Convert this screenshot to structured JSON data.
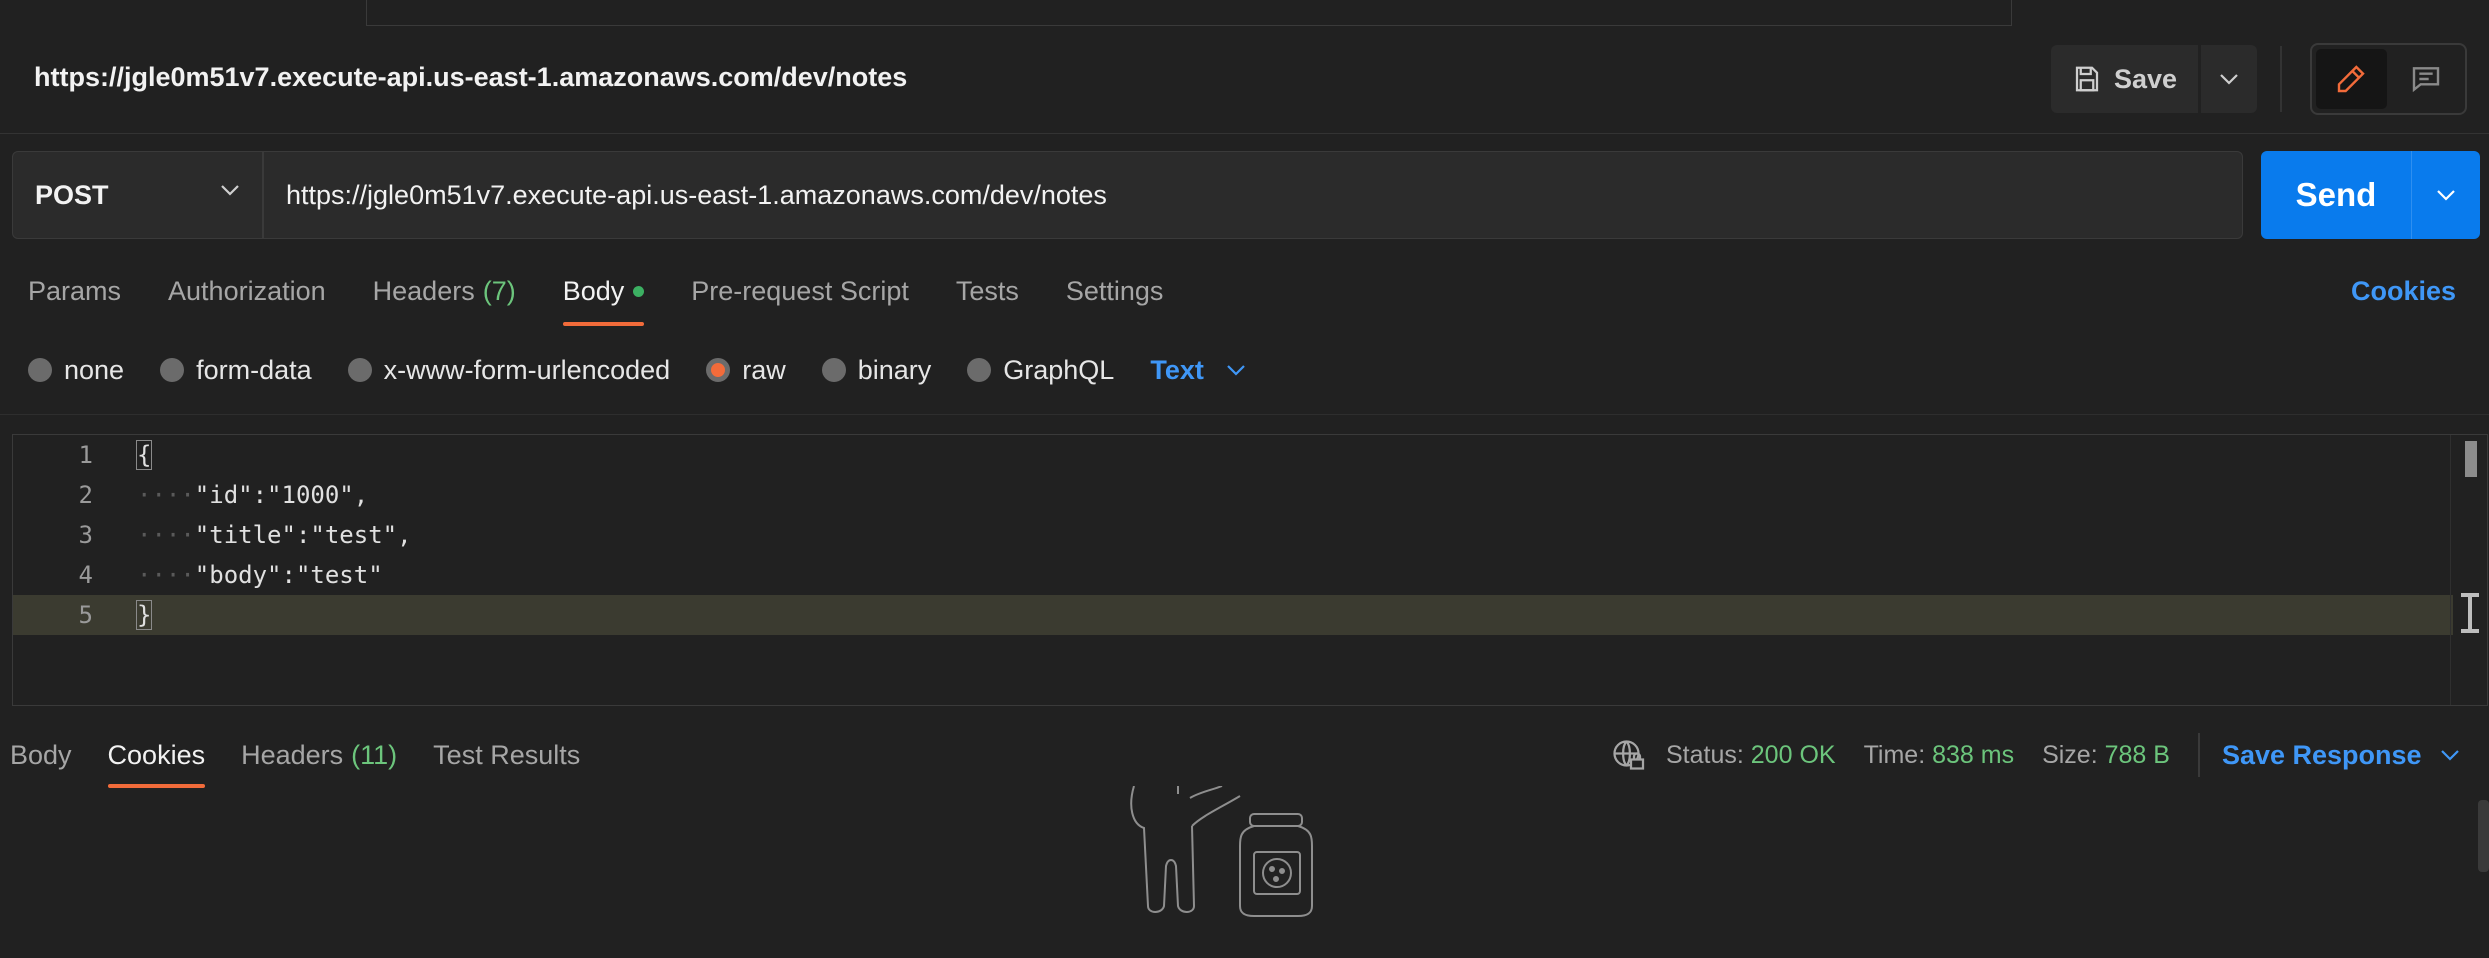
{
  "header": {
    "request_title": "https://jgle0m51v7.execute-api.us-east-1.amazonaws.com/dev/notes",
    "save_label": "Save"
  },
  "url_bar": {
    "method": "POST",
    "url": "https://jgle0m51v7.execute-api.us-east-1.amazonaws.com/dev/notes",
    "send_label": "Send"
  },
  "request_tabs": [
    {
      "label": "Params"
    },
    {
      "label": "Authorization"
    },
    {
      "label": "Headers",
      "count": "(7)"
    },
    {
      "label": "Body",
      "active": true
    },
    {
      "label": "Pre-request Script"
    },
    {
      "label": "Tests"
    },
    {
      "label": "Settings"
    }
  ],
  "cookies_label": "Cookies",
  "body_types": {
    "options": [
      "none",
      "form-data",
      "x-www-form-urlencoded",
      "raw",
      "binary",
      "GraphQL"
    ],
    "selected": "raw",
    "format": "Text"
  },
  "editor": {
    "lines": [
      {
        "num": "1",
        "text": "{"
      },
      {
        "num": "2",
        "text": "\"id\":\"1000\","
      },
      {
        "num": "3",
        "text": "\"title\":\"test\","
      },
      {
        "num": "4",
        "text": "\"body\":\"test\""
      },
      {
        "num": "5",
        "text": "}"
      }
    ]
  },
  "response": {
    "tabs": [
      {
        "label": "Body"
      },
      {
        "label": "Cookies",
        "active": true
      },
      {
        "label": "Headers",
        "count": "(11)"
      },
      {
        "label": "Test Results"
      }
    ],
    "status_label": "Status:",
    "status_value": "200 OK",
    "time_label": "Time:",
    "time_value": "838 ms",
    "size_label": "Size:",
    "size_value": "788 B",
    "save_response_label": "Save Response"
  },
  "colors": {
    "accent_orange": "#f26b3a",
    "send_blue": "#097bed",
    "link_blue": "#3f97f7",
    "success_green": "#6cc57c",
    "background": "#212121"
  }
}
